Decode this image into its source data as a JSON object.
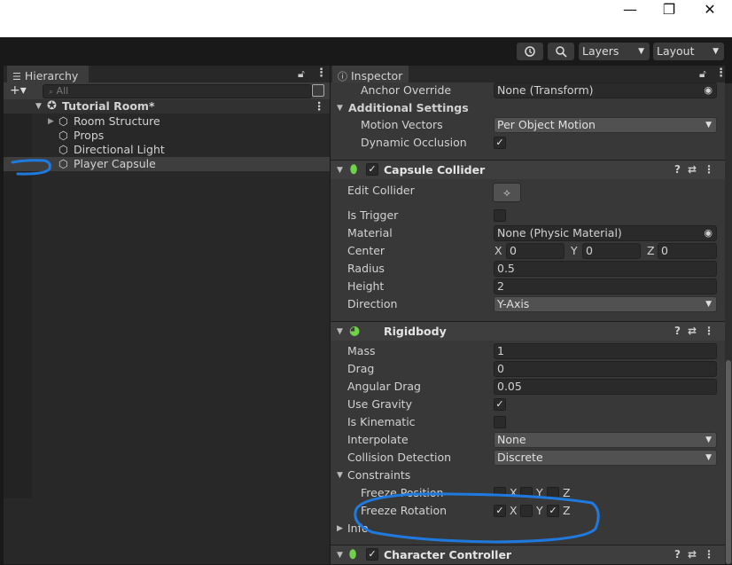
{
  "titlebar": {
    "minimize": "—",
    "maximize": "❐",
    "close": "✕"
  },
  "toolbar": {
    "history_icon": "history-icon",
    "search_icon": "search-icon",
    "layers_label": "Layers",
    "layout_label": "Layout"
  },
  "hierarchy": {
    "tab_label": "Hierarchy",
    "add_label": "+▾",
    "search_placeholder": "All",
    "scene": "Tutorial Room*",
    "items": [
      {
        "label": "Room Structure"
      },
      {
        "label": "Props"
      },
      {
        "label": "Directional Light"
      },
      {
        "label": "Player Capsule"
      }
    ]
  },
  "inspector": {
    "tab_label": "Inspector",
    "anchor_override": {
      "label": "Anchor Override",
      "value": "None (Transform)"
    },
    "additional_settings": {
      "label": "Additional Settings",
      "motion_vectors": {
        "label": "Motion Vectors",
        "value": "Per Object Motion"
      },
      "dynamic_occlusion": {
        "label": "Dynamic Occlusion",
        "checked": true
      }
    },
    "capsule_collider": {
      "title": "Capsule Collider",
      "edit_collider": "Edit Collider",
      "is_trigger": {
        "label": "Is Trigger",
        "checked": false
      },
      "material": {
        "label": "Material",
        "value": "None (Physic Material)"
      },
      "center": {
        "label": "Center",
        "x_label": "X",
        "x": "0",
        "y_label": "Y",
        "y": "0",
        "z_label": "Z",
        "z": "0"
      },
      "radius": {
        "label": "Radius",
        "value": "0.5"
      },
      "height": {
        "label": "Height",
        "value": "2"
      },
      "direction": {
        "label": "Direction",
        "value": "Y-Axis"
      }
    },
    "rigidbody": {
      "title": "Rigidbody",
      "mass": {
        "label": "Mass",
        "value": "1"
      },
      "drag": {
        "label": "Drag",
        "value": "0"
      },
      "angular_drag": {
        "label": "Angular Drag",
        "value": "0.05"
      },
      "use_gravity": {
        "label": "Use Gravity",
        "checked": true
      },
      "is_kinematic": {
        "label": "Is Kinematic",
        "checked": false
      },
      "interpolate": {
        "label": "Interpolate",
        "value": "None"
      },
      "collision_detection": {
        "label": "Collision Detection",
        "value": "Discrete"
      },
      "constraints": "Constraints",
      "freeze_position": {
        "label": "Freeze Position",
        "x": "X",
        "y": "Y",
        "z": "Z"
      },
      "freeze_rotation": {
        "label": "Freeze Rotation",
        "x": "X",
        "y": "Y",
        "z": "Z"
      },
      "info": "Info"
    },
    "character_controller": {
      "title": "Character Controller"
    }
  },
  "colors": {
    "annotation": "#1f7ae0",
    "panel": "#383838",
    "hierarchy": "#282828"
  }
}
